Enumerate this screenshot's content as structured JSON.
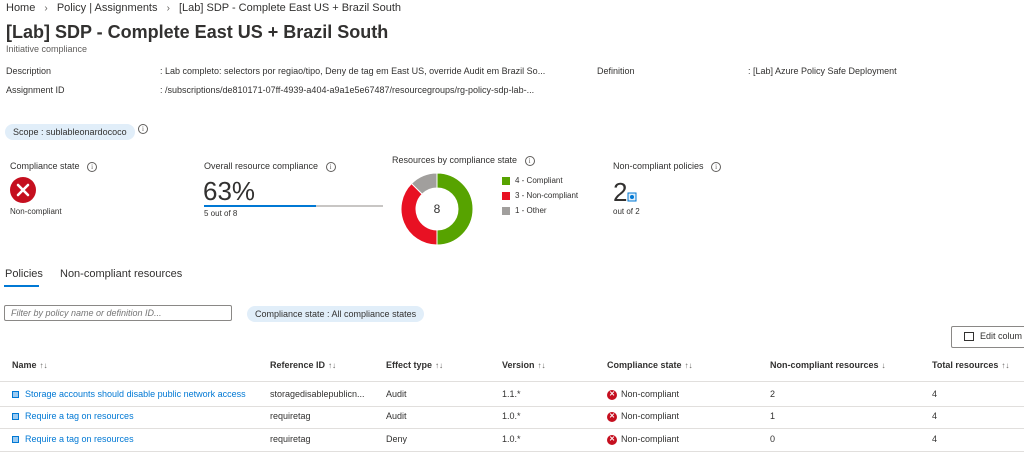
{
  "breadcrumb": [
    "Home",
    "Policy | Assignments",
    "[Lab] SDP - Complete East US + Brazil South"
  ],
  "title": "[Lab] SDP - Complete East US + Brazil South",
  "more": "···",
  "subtitle": "Initiative compliance",
  "essentials": {
    "description_label": "Description",
    "description_value": ": Lab completo: selectors por regiao/tipo, Deny de tag em East US, override Audit em Brazil So...",
    "definition_label": "Definition",
    "definition_value": ": [Lab] Azure Policy Safe Deployment",
    "assignment_label": "Assignment ID",
    "assignment_value": ": /subscriptions/de810171-07ff-4939-a404-a9a1e5e67487/resourcegroups/rg-policy-sdp-lab-..."
  },
  "scope_pill": "Scope : sublableonardococo",
  "cards": {
    "compliance_state": {
      "title": "Compliance state",
      "value": "Non-compliant"
    },
    "overall": {
      "title": "Overall resource compliance",
      "percent": "63%",
      "sub": "5 out of 8",
      "fraction": 0.625
    },
    "by_state": {
      "title": "Resources by compliance state",
      "total": "8"
    },
    "noncompliant_policies": {
      "title": "Non-compliant policies",
      "value": "2",
      "sub": "out of 2"
    }
  },
  "chart_data": {
    "type": "pie",
    "title": "Resources by compliance state",
    "categories": [
      "4 - Compliant",
      "3 - Non-compliant",
      "1 - Other"
    ],
    "values": [
      4,
      3,
      1
    ],
    "colors": [
      "#57a300",
      "#e81123",
      "#a19f9d"
    ]
  },
  "tabs": [
    "Policies",
    "Non-compliant resources"
  ],
  "filter": {
    "placeholder": "Filter by policy name or definition ID..."
  },
  "compliance_filter_pill": "Compliance state : All compliance states",
  "edit_columns": "Edit colum",
  "table": {
    "headers": [
      "Name",
      "Reference ID",
      "Effect type",
      "Version",
      "Compliance state",
      "Non-compliant resources",
      "Total resources"
    ],
    "sort_glyphs": [
      "↑↓",
      "↑↓",
      "↑↓",
      "↑↓",
      "↑↓",
      "↓",
      "↑↓"
    ],
    "rows": [
      [
        "Storage accounts should disable public network access",
        "storagedisablepublicn...",
        "Audit",
        "1.1.*",
        "Non-compliant",
        "2",
        "4"
      ],
      [
        "Require a tag on resources",
        "requiretag",
        "Audit",
        "1.0.*",
        "Non-compliant",
        "1",
        "4"
      ],
      [
        "Require a tag on resources",
        "requiretag",
        "Deny",
        "1.0.*",
        "Non-compliant",
        "0",
        "4"
      ]
    ]
  },
  "colors": {
    "accent": "#0078d4",
    "error": "#c50f1f",
    "compliant": "#57a300",
    "noncompliant": "#e81123",
    "other": "#a19f9d"
  }
}
